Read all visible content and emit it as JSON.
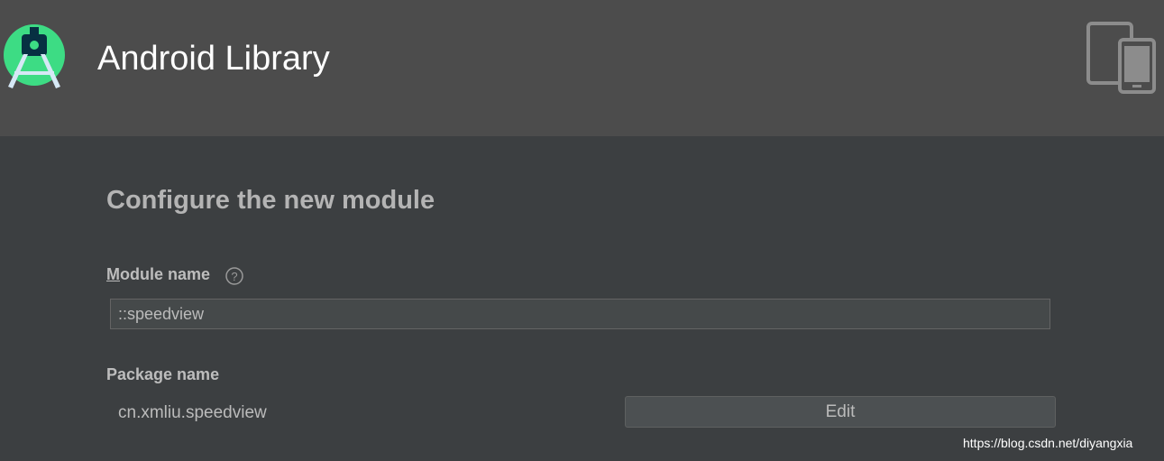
{
  "header": {
    "title": "Android Library",
    "logo_icon": "android-studio-logo",
    "right_icon": "devices-icon"
  },
  "main": {
    "title": "Configure the new module",
    "module_name": {
      "label": "Module name",
      "help_icon": "help-icon",
      "value": "::speedview"
    },
    "package_name": {
      "label": "Package name",
      "value": "cn.xmliu.speedview",
      "edit_label": "Edit"
    }
  },
  "watermark": "https://blog.csdn.net/diyangxia",
  "colors": {
    "header_bg": "#4c4c4c",
    "content_bg": "#3c3f41",
    "logo_green": "#3ddc84"
  }
}
